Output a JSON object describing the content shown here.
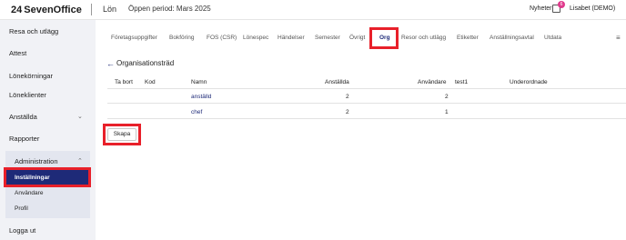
{
  "header": {
    "logo_mark": "24",
    "logo_text": "SevenOffice",
    "module": "Lön",
    "period": "Öppen period: Mars 2025",
    "news_label": "Nyheter",
    "news_count": "6",
    "user": "Lisabet (DEMO)"
  },
  "sidebar": {
    "items": [
      {
        "label": "Resa och utlägg"
      },
      {
        "label": "Attest"
      },
      {
        "label": "Lönekörningar"
      },
      {
        "label": "Löneklienter"
      },
      {
        "label": "Anställda"
      },
      {
        "label": "Rapporter"
      },
      {
        "label": "Administration"
      },
      {
        "label": "Logga ut"
      }
    ],
    "admin_sub": [
      {
        "label": "Inställningar"
      },
      {
        "label": "Användare"
      },
      {
        "label": "Profil"
      }
    ],
    "chevron_down": "⌄",
    "chevron_up": "⌃"
  },
  "tabs": [
    {
      "label": "Företagsuppgifter"
    },
    {
      "label": "Bokföring"
    },
    {
      "label": "FOS (CSR)"
    },
    {
      "label": "Lönespec"
    },
    {
      "label": "Händelser"
    },
    {
      "label": "Semester"
    },
    {
      "label": "Övrigt"
    },
    {
      "label": "Org"
    },
    {
      "label": "Resor och utlägg"
    },
    {
      "label": "Etiketter"
    },
    {
      "label": "Anställningsavtal"
    },
    {
      "label": "Utdata"
    }
  ],
  "main": {
    "back_icon": "←",
    "title": "Organisationsträd",
    "columns": [
      "Ta bort",
      "Kod",
      "Namn",
      "Anställda",
      "Användare",
      "test1",
      "Underordnade"
    ],
    "rows": [
      {
        "namn": "anställd",
        "anstallda": "2",
        "anvandare": "2"
      },
      {
        "namn": "chef",
        "anstallda": "2",
        "anvandare": "1"
      }
    ],
    "create_button": "Skapa"
  },
  "colors": {
    "accent": "#1e2a78",
    "highlight": "#e8202a",
    "sidebar_bg": "#f1f2f6"
  }
}
